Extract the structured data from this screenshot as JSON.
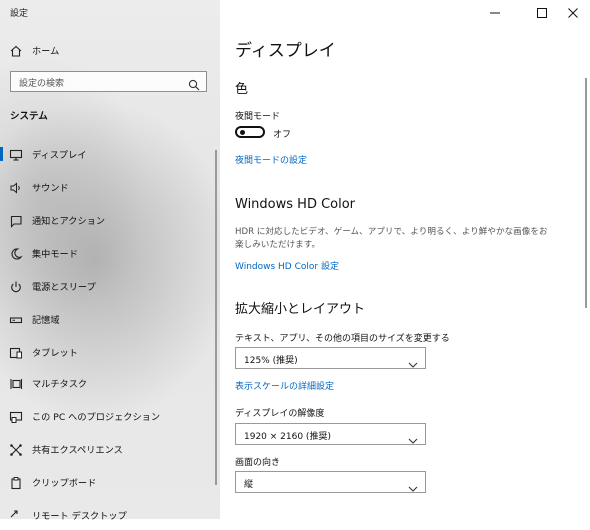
{
  "app": {
    "title": "設定"
  },
  "window_controls": {
    "minimize_icon": "minimize-icon",
    "maximize_icon": "maximize-icon",
    "close_icon": "close-icon"
  },
  "sidebar": {
    "home": {
      "label": "ホーム",
      "icon": "home-icon"
    },
    "search": {
      "placeholder": "設定の検索",
      "icon": "search-icon"
    },
    "section": "システム",
    "items": [
      {
        "label": "ディスプレイ",
        "icon": "monitor-icon",
        "selected": true
      },
      {
        "label": "サウンド",
        "icon": "speaker-icon"
      },
      {
        "label": "通知とアクション",
        "icon": "notification-icon"
      },
      {
        "label": "集中モード",
        "icon": "moon-icon"
      },
      {
        "label": "電源とスリープ",
        "icon": "power-icon"
      },
      {
        "label": "記憶域",
        "icon": "storage-icon"
      },
      {
        "label": "タブレット",
        "icon": "tablet-icon"
      },
      {
        "label": "マルチタスク",
        "icon": "multitask-icon"
      },
      {
        "label": "この PC へのプロジェクション",
        "icon": "projection-icon"
      },
      {
        "label": "共有エクスペリエンス",
        "icon": "shared-icon"
      },
      {
        "label": "クリップボード",
        "icon": "clipboard-icon"
      },
      {
        "label": "リモート デスクトップ",
        "icon": "remote-desktop-icon"
      }
    ]
  },
  "main": {
    "title": "ディスプレイ",
    "color": {
      "heading": "色",
      "night_light_label": "夜間モード",
      "night_light_state": "オフ",
      "night_light_link": "夜間モードの設定"
    },
    "hdr": {
      "heading": "Windows HD Color",
      "description": "HDR に対応したビデオ、ゲーム、アプリで、より明るく、より鮮やかな画像をお楽しみいただけます。",
      "link": "Windows HD Color 設定"
    },
    "scale_layout": {
      "heading": "拡大縮小とレイアウト",
      "scale_label": "テキスト、アプリ、その他の項目のサイズを変更する",
      "scale_value": "125% (推奨)",
      "advanced_link": "表示スケールの詳細設定",
      "resolution_label": "ディスプレイの解像度",
      "resolution_value": "1920 × 2160 (推奨)",
      "orientation_label": "画面の向き",
      "orientation_value": "縦"
    }
  }
}
